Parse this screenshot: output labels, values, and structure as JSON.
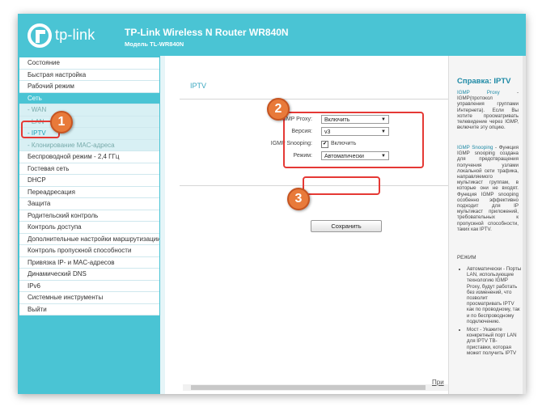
{
  "header": {
    "logo_text": "tp-link",
    "title": "TP-Link Wireless N Router WR840N",
    "model": "Модель TL-WR840N"
  },
  "sidebar": {
    "items": [
      {
        "label": "Состояние"
      },
      {
        "label": "Быстрая настройка"
      },
      {
        "label": "Рабочий режим"
      },
      {
        "label": "Сеть",
        "active": true
      },
      {
        "label": "- WAN",
        "sub": true
      },
      {
        "label": "- LAN",
        "sub": true
      },
      {
        "label": "- IPTV",
        "sub": true,
        "current": true
      },
      {
        "label": "- Клонирование MAC-адреса",
        "sub": true
      },
      {
        "label": "Беспроводной режим - 2,4 ГГц"
      },
      {
        "label": "Гостевая сеть"
      },
      {
        "label": "DHCP"
      },
      {
        "label": "Переадресация"
      },
      {
        "label": "Защита"
      },
      {
        "label": "Родительский контроль"
      },
      {
        "label": "Контроль доступа"
      },
      {
        "label": "Дополнительные настройки маршрутизации"
      },
      {
        "label": "Контроль пропускной способности"
      },
      {
        "label": "Привязка IP- и MAC-адресов"
      },
      {
        "label": "Динамический DNS"
      },
      {
        "label": "IPv6"
      },
      {
        "label": "Системные инструменты"
      },
      {
        "label": "Выйти"
      }
    ]
  },
  "main": {
    "section_title": "IPTV",
    "form": {
      "igmp_proxy_label": "IGMP Proxy:",
      "igmp_proxy_value": "Включить",
      "version_label": "Версия:",
      "version_value": "v3",
      "snooping_label": "IGMP Snooping:",
      "snooping_checked": true,
      "snooping_text": "Включить",
      "mode_label": "Режим:",
      "mode_value": "Автоматически"
    },
    "save_label": "Сохранить"
  },
  "annotations": {
    "badge1": "1",
    "badge2": "2",
    "badge3": "3"
  },
  "help": {
    "title": "Справка: IPTV",
    "p1_head": "IGMP Proxy",
    "p1_body": " - IGMP(протокол управления группами Интернета). Если Вы хотите просматривать телевидение через IGMP, включите эту опцию.",
    "p2_head": "IGMP Snooping",
    "p2_body": " - Функция IGMP snooping создана для предотвращения получения узлами локальной сети трафика, направляемого мультикаст группам, в которые они не входят. Функция IGMP snooping особенно эффективно подходит для IP мультикаст приложений, требовательных к пропускной способности, таких как IPTV.",
    "mode_head": "РЕЖИМ",
    "bullet1": "Автоматически - Порты LAN, использующие технологию IGMP Proxy, будут работать без изменений, что позволит просматривать IPTV как по проводному, так и по беспроводному подключению.",
    "bullet2": "Мост - Укажите конкретный порт LAN для IPTV ТВ-приставки, которая может получить IPTV"
  },
  "print_link": "При",
  "colors": {
    "brand": "#4ac4d4",
    "accent_red": "#e53935",
    "badge_orange": "#e87a3a"
  }
}
